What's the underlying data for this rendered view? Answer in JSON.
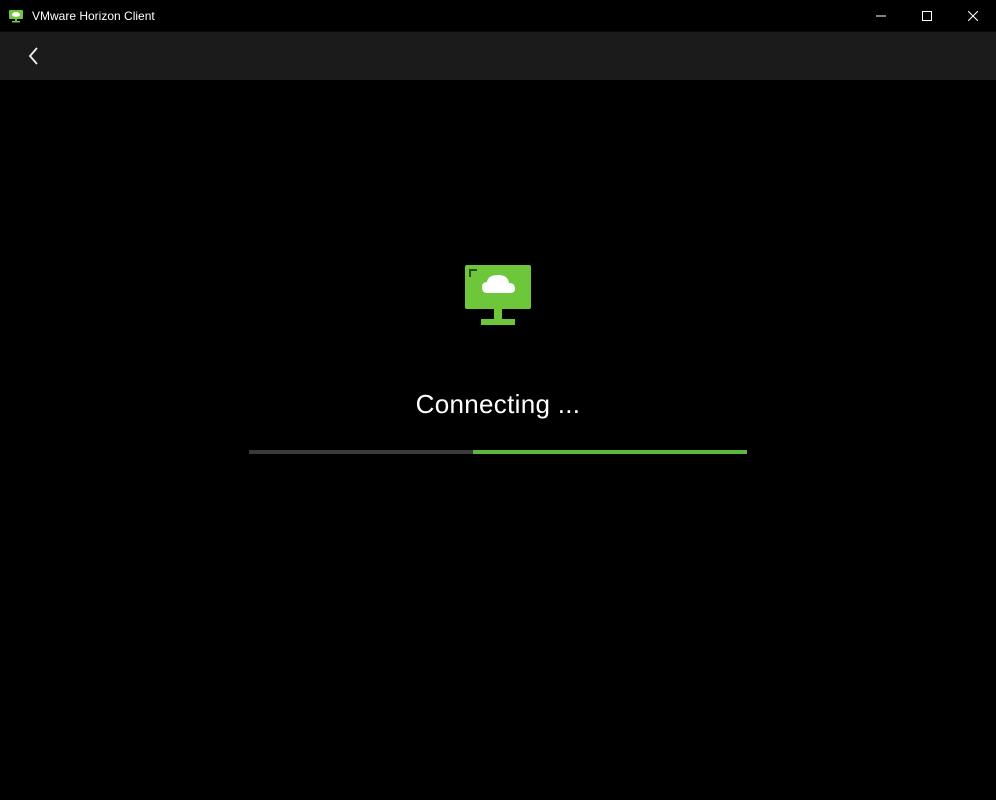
{
  "window": {
    "title": "VMware Horizon Client"
  },
  "status": {
    "message": "Connecting ..."
  },
  "progress": {
    "percent": 54,
    "startPercent": 45
  },
  "colors": {
    "accent": "#5fb83e",
    "accentBright": "#6ec73a"
  }
}
